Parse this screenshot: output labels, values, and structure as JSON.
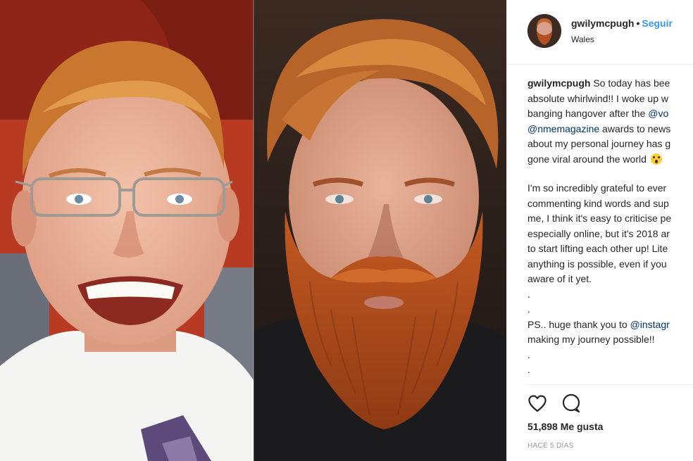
{
  "post": {
    "photo": {
      "left_label": "before photo",
      "right_label": "after photo"
    },
    "header": {
      "username": "gwilymcpugh",
      "separator": "•",
      "follow_label": "Seguir",
      "location": "Wales"
    },
    "caption": {
      "username": "gwilymcpugh",
      "line1_rest": " So today has bee",
      "line2": "absolute whirlwind!! I woke up w",
      "line3_pre": "banging hangover after the ",
      "line3_mention": "@vo",
      "line4_mention": "@nmemagazine",
      "line4_rest": " awards to news",
      "line5": "about my personal journey has g",
      "line6": "gone viral around the world",
      "para2": [
        "I'm so incredibly grateful to ever",
        "commenting kind words and sup",
        "me, I think it's easy to criticise pe",
        "especially online, but it's 2018 ar",
        "to start lifting each other up! Lite",
        "anything is possible, even if you",
        "aware of it yet."
      ],
      "dot1": ".",
      "dot2": ".",
      "ps_pre": "PS.. huge thank you to ",
      "ps_mention": "@instagr",
      "ps_line2": "making my journey possible!!",
      "dot3": ".",
      "dot4": "."
    },
    "likes": "51,898 Me gusta",
    "timestamp": "HACE 5 DÍAS",
    "icons": {
      "like": "heart-icon",
      "comment": "comment-bubble-icon"
    },
    "colors": {
      "link": "#3897f0",
      "mention": "#003569",
      "text": "#262626",
      "muted": "#999999",
      "divider": "#efefef"
    }
  }
}
